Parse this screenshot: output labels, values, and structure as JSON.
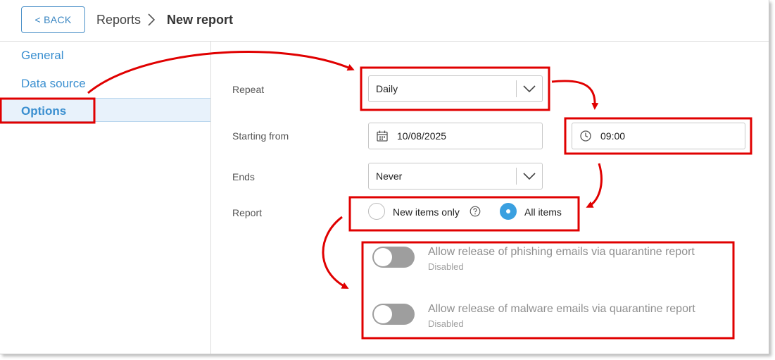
{
  "header": {
    "back_label": "< BACK",
    "breadcrumb_parent": "Reports",
    "breadcrumb_current": "New report"
  },
  "sidebar": {
    "items": [
      {
        "label": "General"
      },
      {
        "label": "Data source"
      },
      {
        "label": "Options",
        "active": true
      }
    ]
  },
  "form": {
    "repeat": {
      "label": "Repeat",
      "value": "Daily"
    },
    "starting_from": {
      "label": "Starting from",
      "date": "10/08/2025",
      "time": "09:00"
    },
    "ends": {
      "label": "Ends",
      "value": "Never"
    },
    "report": {
      "label": "Report",
      "options": [
        {
          "label": "New items only",
          "selected": false
        },
        {
          "label": "All items",
          "selected": true
        }
      ]
    },
    "toggles": [
      {
        "title": "Allow release of phishing emails via quarantine report",
        "status": "Disabled",
        "on": false
      },
      {
        "title": "Allow release of malware emails via quarantine report",
        "status": "Disabled",
        "on": false
      }
    ]
  },
  "colors": {
    "accent": "#3a8fd0",
    "radio_selected": "#3aa0e0",
    "toggle_off": "#9e9e9e",
    "annotation_red": "#e00000"
  },
  "icons": [
    "chevron-right-icon",
    "dropdown-arrow-icon",
    "calendar-icon",
    "clock-icon",
    "help-circle-icon"
  ]
}
